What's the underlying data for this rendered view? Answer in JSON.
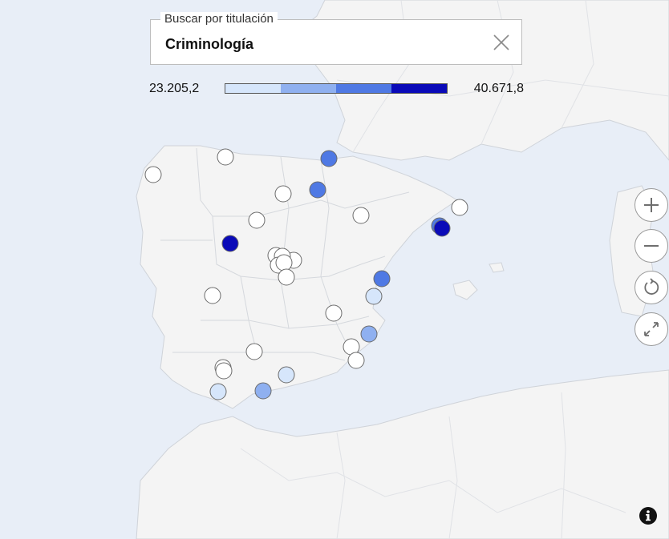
{
  "search": {
    "label": "Buscar por titulación",
    "value": "Criminología"
  },
  "legend": {
    "min_label": "23.205,2",
    "max_label": "40.671,8",
    "colors": [
      "#d6e6fb",
      "#8fb0f0",
      "#4f79e4",
      "#0a0ab8"
    ]
  },
  "colors": {
    "sea": "#e8eef7",
    "land": "#f4f4f4",
    "border": "#cfd3d9",
    "marker_empty": "#ffffff",
    "marker_stroke": "#6b6b6b"
  },
  "controls": {
    "zoom_in": "zoom-in-icon",
    "zoom_out": "zoom-out-icon",
    "reset": "reset-view-icon",
    "fullscreen": "fullscreen-icon",
    "info": "info-icon"
  }
}
